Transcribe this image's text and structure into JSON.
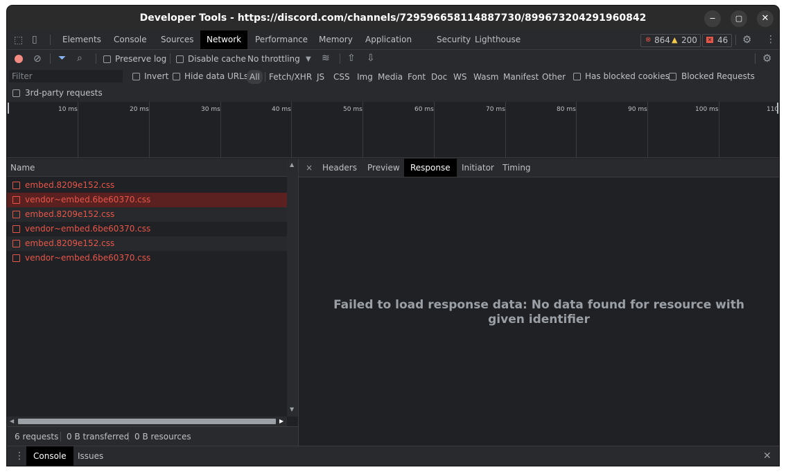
{
  "window": {
    "title": "Developer Tools - https://discord.com/channels/729596658114887730/899673204291960842"
  },
  "main_tabs": [
    "Elements",
    "Console",
    "Sources",
    "Network",
    "Performance",
    "Memory",
    "Application",
    "Security",
    "Lighthouse"
  ],
  "active_tab": "Network",
  "counters": {
    "errors": "864",
    "warnings": "200",
    "issues": "46"
  },
  "toolbar": {
    "preserve_log": "Preserve log",
    "disable_cache": "Disable cache",
    "throttling": "No throttling"
  },
  "filter": {
    "placeholder": "Filter",
    "invert": "Invert",
    "hide_data_urls": "Hide data URLs",
    "types": [
      "All",
      "Fetch/XHR",
      "JS",
      "CSS",
      "Img",
      "Media",
      "Font",
      "Doc",
      "WS",
      "Wasm",
      "Manifest",
      "Other"
    ],
    "has_blocked_cookies": "Has blocked cookies",
    "blocked_requests": "Blocked Requests",
    "third_party": "3rd-party requests"
  },
  "timeline": {
    "ticks": [
      "10 ms",
      "20 ms",
      "30 ms",
      "40 ms",
      "50 ms",
      "60 ms",
      "70 ms",
      "80 ms",
      "90 ms",
      "100 ms",
      "110"
    ]
  },
  "requests": {
    "header": "Name",
    "rows": [
      "embed.8209e152.css",
      "vendor~embed.6be60370.css",
      "embed.8209e152.css",
      "vendor~embed.6be60370.css",
      "embed.8209e152.css",
      "vendor~embed.6be60370.css"
    ]
  },
  "summary": {
    "requests": "6 requests",
    "transferred": "0 B transferred",
    "resources": "0 B resources"
  },
  "detail": {
    "close": "×",
    "tabs": [
      "Headers",
      "Preview",
      "Response",
      "Initiator",
      "Timing"
    ],
    "active": "Response",
    "message": "Failed to load response data: No data found for resource with given identifier"
  },
  "drawer": {
    "tabs": [
      "Console",
      "Issues"
    ],
    "active": "Console"
  },
  "colors": {
    "error_red": "#e8564a",
    "selected_row": "#5b2120",
    "accent_blue": "#8ab4f8"
  }
}
